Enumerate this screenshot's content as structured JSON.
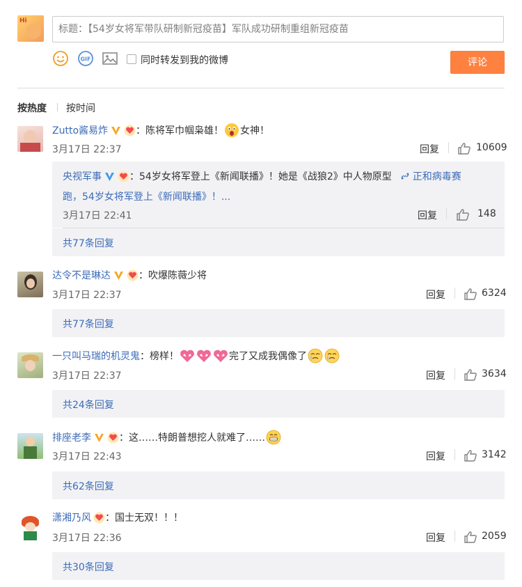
{
  "composer": {
    "placeholder": "标题：【54岁女将军带队研制新冠疫苗】军队成功研制重组新冠疫苗",
    "repost_label": "同时转发到我的微博",
    "submit_label": "评论"
  },
  "sort": {
    "hot": "按热度",
    "time": "按时间"
  },
  "colors": {
    "accent": "#ff8140",
    "link": "#3b6bb8",
    "sub_bg": "#f2f2f5"
  },
  "comments": [
    {
      "user": "Zutto酱易炸",
      "sep": "：",
      "text1": "陈将军巾帼枭雄！",
      "text2": "女神！",
      "time": "3月17日 22:37",
      "reply": "回复",
      "likes": "10609",
      "more": "共77条回复",
      "sub": {
        "user": "央视军事",
        "sep": "：",
        "text": "54岁女将军登上《新闻联播》！她是《战狼2》中人物原型",
        "link": "正和病毒赛",
        "line2": "跑，54岁女将军登上《新闻联播》！...",
        "time": "3月17日 22:41",
        "reply": "回复",
        "likes": "148"
      }
    },
    {
      "user": "达令不是琳达",
      "sep": "：",
      "text1": "吹爆陈薇少将",
      "time": "3月17日 22:37",
      "reply": "回复",
      "likes": "6324",
      "more": "共77条回复"
    },
    {
      "user": "一只叫马瑞的机灵鬼",
      "sep": "：",
      "text1": "榜样！",
      "text2": "完了又成我偶像了",
      "time": "3月17日 22:37",
      "reply": "回复",
      "likes": "3634",
      "more": "共24条回复"
    },
    {
      "user": "排座老李",
      "sep": "：",
      "text1": "这……特朗普想挖人就难了……",
      "time": "3月17日 22:43",
      "reply": "回复",
      "likes": "3142",
      "more": "共62条回复"
    },
    {
      "user": "潇湘乃风",
      "sep": "：",
      "text1": "国士无双！！！",
      "time": "3月17日 22:36",
      "reply": "回复",
      "likes": "2059",
      "more": "共30条回复"
    }
  ]
}
